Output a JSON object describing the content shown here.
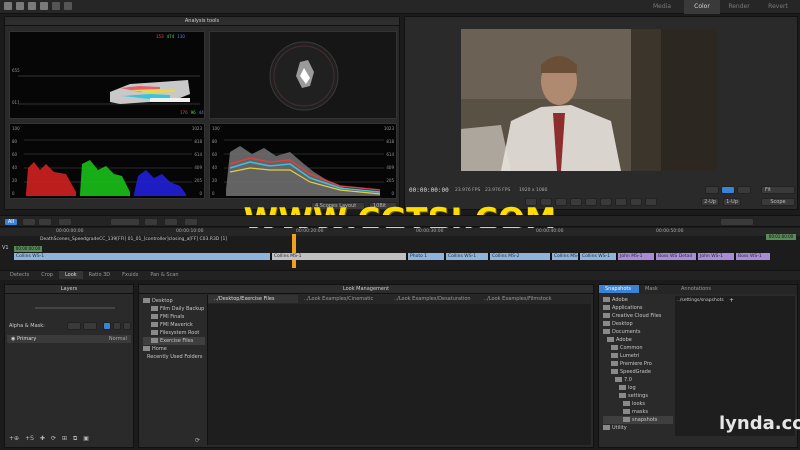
{
  "top_tabs": [
    "Media",
    "Color",
    "Render",
    "Revert"
  ],
  "analysis": {
    "title": "Analysis tools",
    "wave_labels_top": [
      "153",
      "474",
      "130"
    ],
    "wave_labels_bottom": [
      "176",
      "96",
      "44"
    ],
    "wave_side": [
      "655",
      "011"
    ],
    "rgb_left_ticks": [
      "100",
      "80",
      "60",
      "40",
      "20",
      "0"
    ],
    "rgb_right_ticks": [
      "1023",
      "818",
      "614",
      "409",
      "205",
      "0"
    ],
    "comp_left_ticks": [
      "100",
      "80",
      "60",
      "40",
      "20",
      "0"
    ],
    "comp_right_ticks": [
      "1023",
      "818",
      "614",
      "409",
      "205",
      "0"
    ],
    "layout_select": "4 Scopes Layout",
    "bit_select": "10Bit"
  },
  "viewer": {
    "timecode": "00:00:00:00",
    "fps1": "23.976 FPS",
    "fps2": "23.976 FPS",
    "resolution": "1920 x 1080",
    "fit": "Fit",
    "up2": "2-Up",
    "up1": "1-Up",
    "scope_btn": "Scope"
  },
  "watermark": "WWW.CGTSJ.COM",
  "toolbar": {
    "all": "All",
    "labels": [
      "All",
      "⇆",
      "+",
      "−",
      "▸",
      "−",
      "+ Add",
      "+",
      "●",
      "⊞",
      "⧉",
      "Effects"
    ]
  },
  "timeline": {
    "path": "DeathScenes_SpeedgradeCC_139[FFI] 01_01_[controller]closing_a[FF] C03.R3D [1]",
    "timecode_marks": [
      "00:00:00:00",
      "00:00:10:00",
      "00:00:20:00",
      "00:00:30:00",
      "00:00:40:00",
      "00:00:50:00",
      "00:01:00:00"
    ],
    "track_label": "V1",
    "current_tc": "00:00:00:00",
    "end_tc": "00:01:00:00",
    "clips": [
      "Collins WS-1",
      "Collins MS-1",
      "Collins MS-2",
      "Collins WS-1",
      "Collins MS-1",
      "Collins WS-1",
      "Photo 1",
      "Collins WS-1",
      "Collins MS-2",
      "Collins MS-1",
      "Collins WS-1",
      "John MS-1",
      "John MS-2",
      "Boss WS Detail",
      "John WS-1",
      "Boss WS-1"
    ]
  },
  "panel_tabs": [
    "Detects",
    "Crop",
    "Look",
    "Ratio 3D",
    "Fxuids",
    "Pan & Scan"
  ],
  "layers": {
    "title": "Layers",
    "alpha_label": "Alpha & Mask:",
    "layer_name": "Primary",
    "mode": "Normal"
  },
  "look_management": {
    "title": "Look Management",
    "tree": [
      "Desktop",
      "Film Daily Backup",
      "FMI Finals",
      "FMI Maverick",
      "Filesystem Root",
      "Exercise Files",
      "Home",
      "Recently Used Folders"
    ],
    "tabs": [
      "../Desktop/Exercise Files",
      "../Look Examples/Cinematic",
      "../Look Examples/Desaturation",
      "../Look Examples/Filmstock"
    ]
  },
  "snapshots": {
    "tabs": [
      "Snapshots",
      "Mask",
      "Annotations"
    ],
    "path": "../settings/snapshots",
    "tree": [
      "Adobe",
      "Applications",
      "Creative Cloud Files",
      "Desktop",
      "Documents",
      "Adobe",
      "Common",
      "Lumetri",
      "Premiere Pro",
      "SpeedGrade",
      "7.0",
      "log",
      "settings",
      "looks",
      "masks",
      "snapshots",
      "Utility"
    ]
  },
  "logo": "lynda.com",
  "colors": {
    "accent": "#3a82d6",
    "watermark": "#ffdd00",
    "clip_blue": "#8fb4db",
    "clip_purple": "#a98bd6"
  }
}
